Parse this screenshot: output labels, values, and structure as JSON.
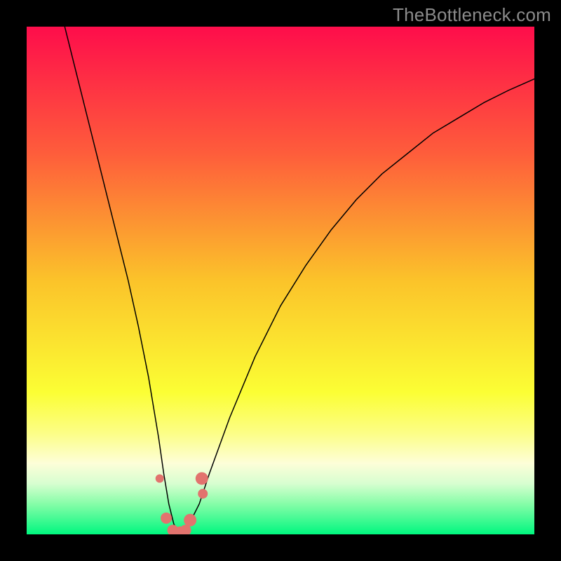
{
  "watermark": "TheBottleneck.com",
  "chart_data": {
    "type": "line",
    "title": "",
    "xlabel": "",
    "ylabel": "",
    "xlim": [
      0,
      100
    ],
    "ylim": [
      0,
      100
    ],
    "background_gradient_stops": [
      {
        "offset": 0.0,
        "color": "#fe0d4b"
      },
      {
        "offset": 0.25,
        "color": "#fe5d3b"
      },
      {
        "offset": 0.5,
        "color": "#fbc32a"
      },
      {
        "offset": 0.72,
        "color": "#fbfe34"
      },
      {
        "offset": 0.8,
        "color": "#fcfe85"
      },
      {
        "offset": 0.86,
        "color": "#fdfed8"
      },
      {
        "offset": 0.9,
        "color": "#d7fed0"
      },
      {
        "offset": 0.94,
        "color": "#86fda8"
      },
      {
        "offset": 1.0,
        "color": "#00f77f"
      }
    ],
    "series": [
      {
        "name": "bottleneck-curve",
        "stroke": "#000000",
        "stroke_width": 1.5,
        "x": [
          7.5,
          10,
          12,
          14,
          16,
          18,
          20,
          22,
          24,
          26,
          27,
          28,
          29,
          30,
          31,
          32,
          34,
          36,
          40,
          45,
          50,
          55,
          60,
          65,
          70,
          75,
          80,
          85,
          90,
          95,
          100
        ],
        "y": [
          100,
          90,
          82,
          74,
          66,
          58,
          50,
          41,
          31,
          19,
          12,
          6,
          2,
          0.5,
          0.5,
          2,
          6,
          12,
          23,
          35,
          45,
          53,
          60,
          66,
          71,
          75,
          79,
          82,
          85,
          87.5,
          89.7
        ]
      }
    ],
    "markers": {
      "name": "highlight-dots",
      "fill": "#e2736e",
      "points": [
        {
          "x": 26.2,
          "y": 11.0,
          "r": 6
        },
        {
          "x": 27.5,
          "y": 3.2,
          "r": 8
        },
        {
          "x": 28.8,
          "y": 0.8,
          "r": 8
        },
        {
          "x": 30.2,
          "y": 0.6,
          "r": 7
        },
        {
          "x": 31.3,
          "y": 0.8,
          "r": 8
        },
        {
          "x": 32.2,
          "y": 2.8,
          "r": 9
        },
        {
          "x": 34.5,
          "y": 11.0,
          "r": 9
        },
        {
          "x": 34.7,
          "y": 8.0,
          "r": 7
        }
      ]
    }
  }
}
